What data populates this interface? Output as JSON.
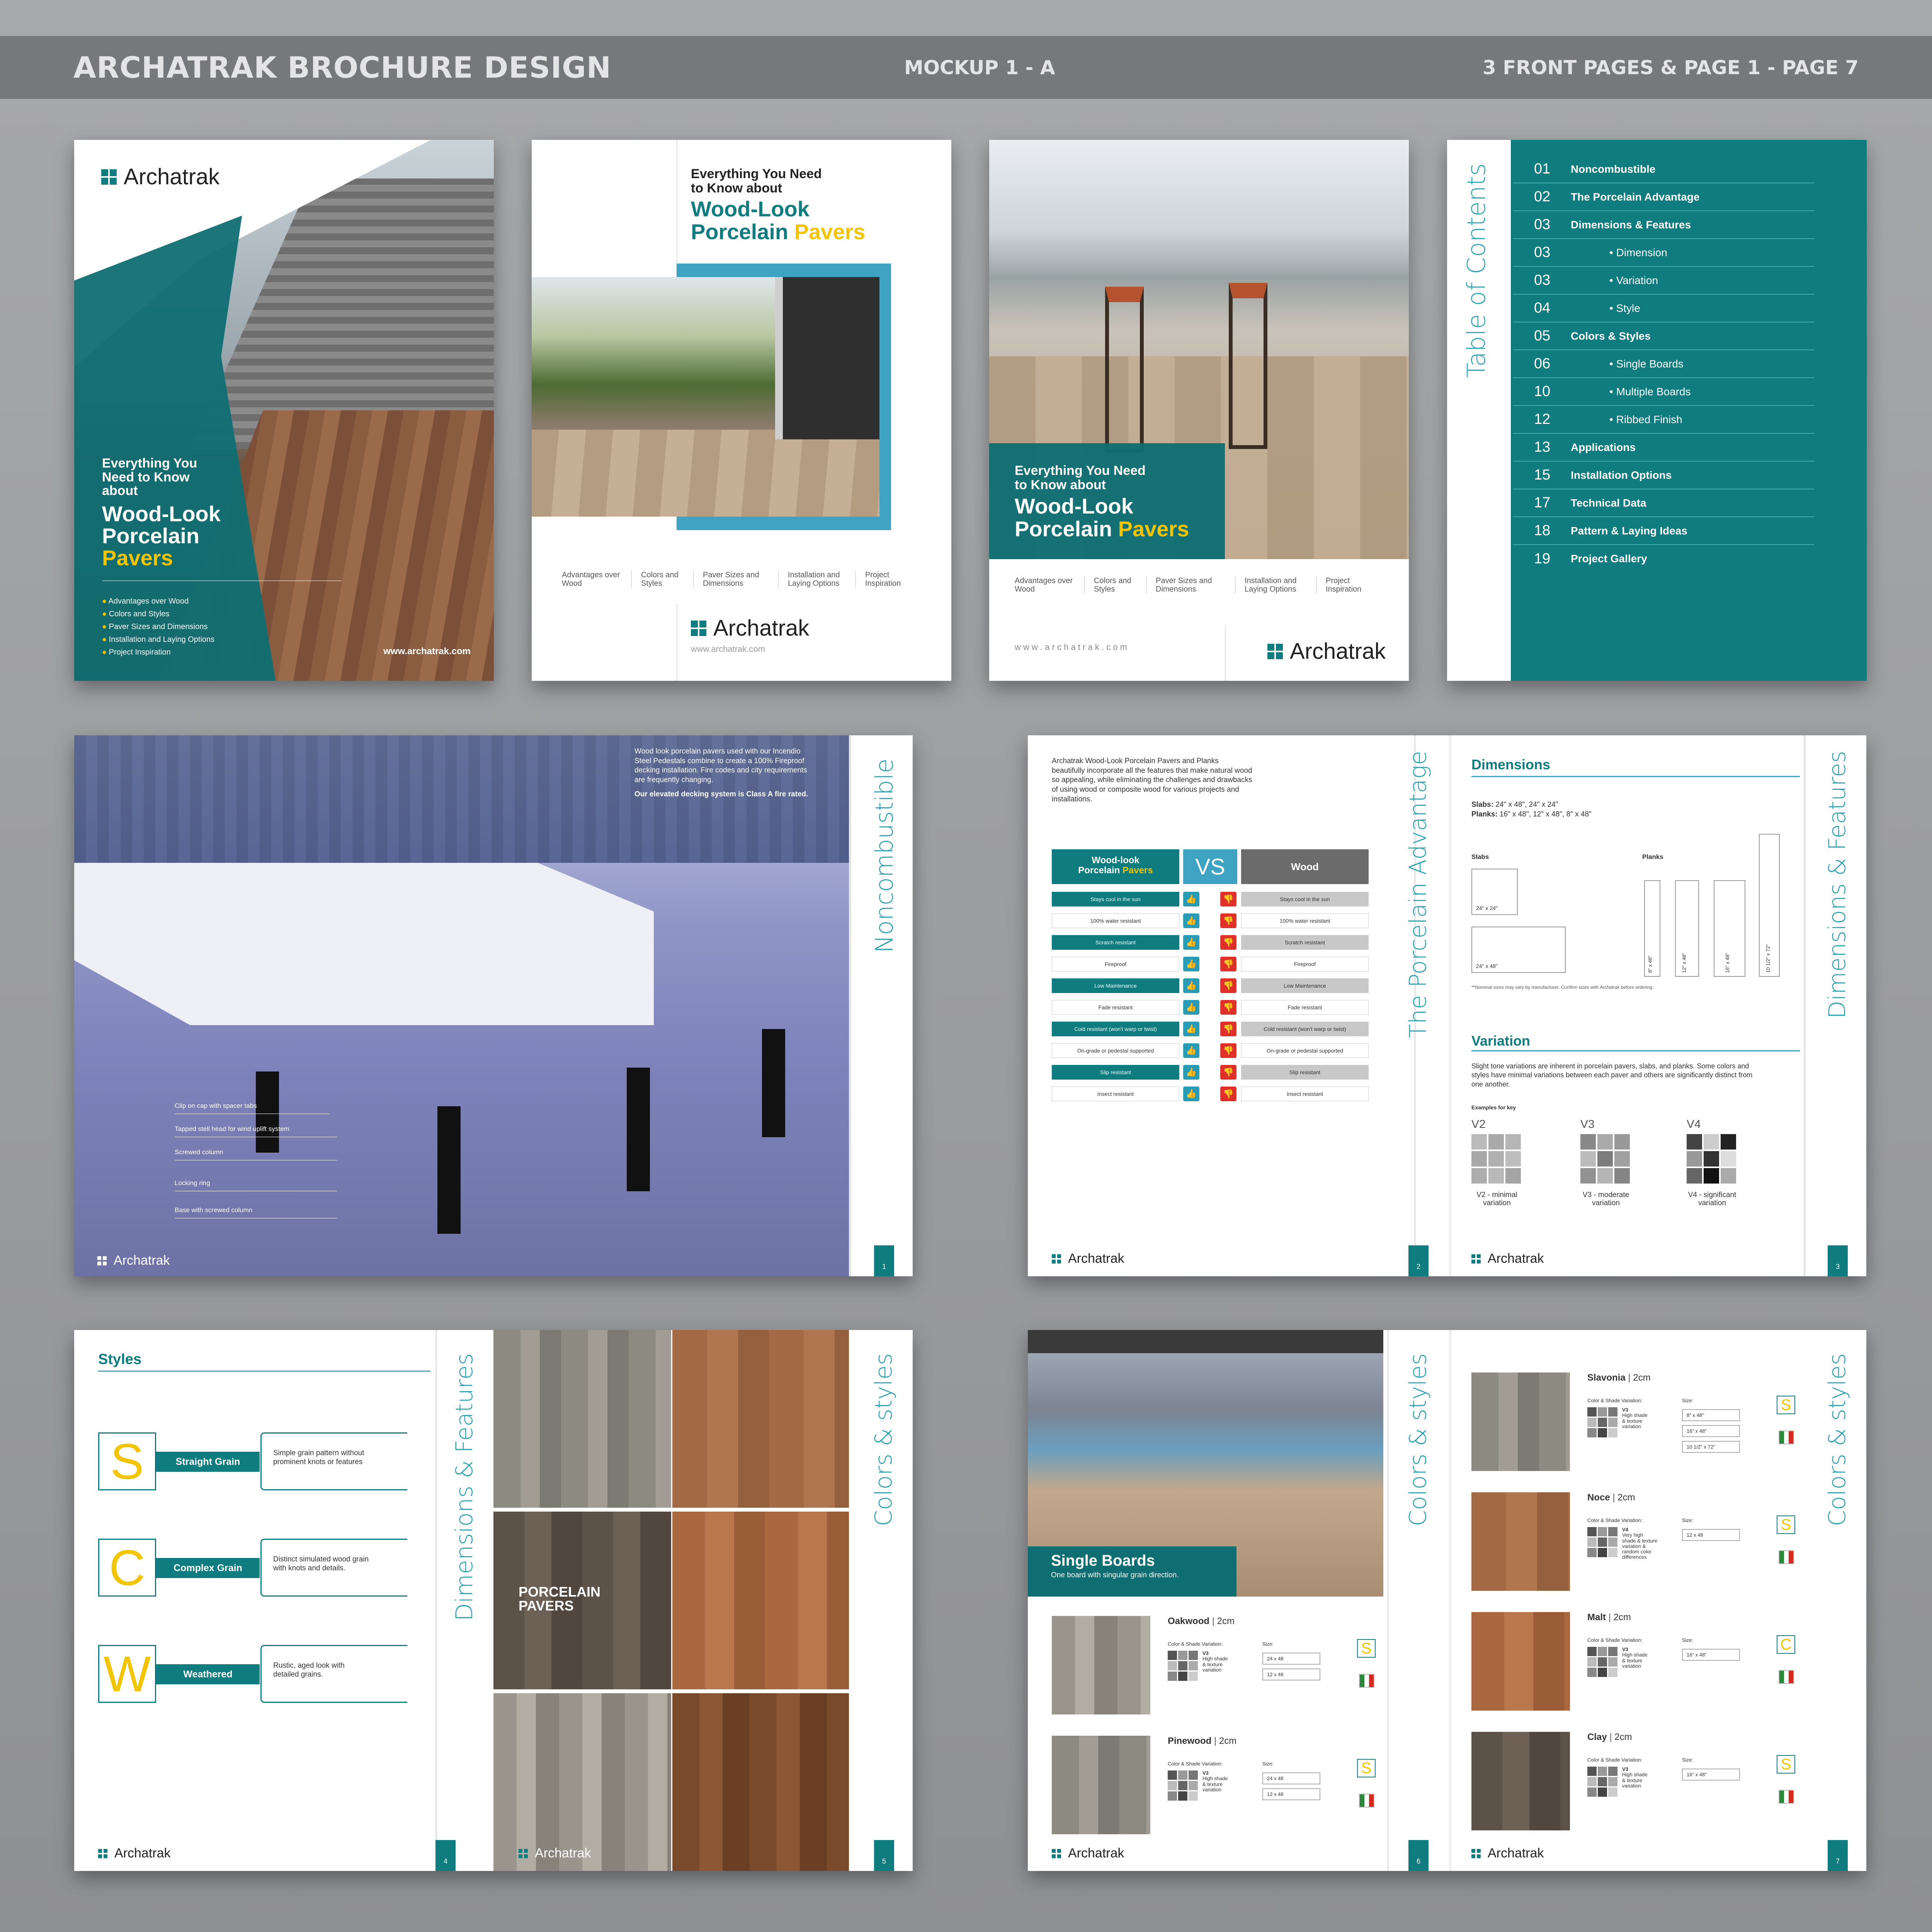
{
  "header": {
    "title": "ARCHATRAK BROCHURE DESIGN",
    "mockup": "MOCKUP 1 - A",
    "pages": "3 FRONT PAGES & PAGE 1 - PAGE 7"
  },
  "brand": {
    "name": "Archatrak",
    "url_cover": "www.archatrak.com",
    "url_plain": "www.archatrak.com",
    "url_spaced": "w w w . a r c h a t r a k . c o m",
    "teal": "#0f7c80",
    "yellow": "#f2c500"
  },
  "cover1": {
    "lead1": "Everything You",
    "lead2": "Need to Know",
    "lead3": "about",
    "h1": "Wood-Look",
    "h2": "Porcelain",
    "h3": "Pavers",
    "bullets": [
      "Advantages over Wood",
      "Colors and Styles",
      "Paver Sizes and Dimensions",
      "Installation and Laying Options",
      "Project Inspiration"
    ]
  },
  "cover2": {
    "lead1": "Everything You Need",
    "lead2": "to Know about",
    "h1": "Wood-Look",
    "h2a": "Porcelain ",
    "h2b": "Pavers",
    "nav": [
      "Advantages over Wood",
      "Colors and Styles",
      "Paver Sizes and Dimensions",
      "Installation and Laying Options",
      "Project Inspiration"
    ]
  },
  "cover3": {
    "lead1": "Everything You Need",
    "lead2": "to Know about",
    "h1": "Wood-Look",
    "h2a": "Porcelain ",
    "h2b": "Pavers",
    "nav": [
      "Advantages over Wood",
      "Colors and Styles",
      "Paver Sizes and Dimensions",
      "Installation and Laying Options",
      "Project Inspiration"
    ]
  },
  "toc": {
    "title": "Table of Contents",
    "items": [
      {
        "num": "01",
        "label": "Noncombustible",
        "sub": false
      },
      {
        "num": "02",
        "label": "The Porcelain Advantage",
        "sub": false
      },
      {
        "num": "03",
        "label": "Dimensions & Features",
        "sub": false
      },
      {
        "num": "03",
        "label": "Dimension",
        "sub": true
      },
      {
        "num": "03",
        "label": "Variation",
        "sub": true
      },
      {
        "num": "04",
        "label": "Style",
        "sub": true
      },
      {
        "num": "05",
        "label": "Colors & Styles",
        "sub": false
      },
      {
        "num": "06",
        "label": "Single Boards",
        "sub": true
      },
      {
        "num": "10",
        "label": "Multiple Boards",
        "sub": true
      },
      {
        "num": "12",
        "label": "Ribbed Finish",
        "sub": true
      },
      {
        "num": "13",
        "label": "Applications",
        "sub": false
      },
      {
        "num": "15",
        "label": "Installation Options",
        "sub": false
      },
      {
        "num": "17",
        "label": "Technical Data",
        "sub": false
      },
      {
        "num": "18",
        "label": "Pattern & Laying Ideas",
        "sub": false
      },
      {
        "num": "19",
        "label": "Project Gallery",
        "sub": false
      }
    ]
  },
  "page1": {
    "side_title": "Noncombustible",
    "intro": "Wood look porcelain pavers used with our Incendio Steel Pedestals combine to create a 100% Fireproof decking installation. Fire codes and city requirements are frequently changing.",
    "intro_bold": "Our elevated decking system is Class A fire rated.",
    "callouts": [
      "Clip on cap with spacer tabs",
      "Tapped stell head for wind uplift system",
      "Screwed column",
      "Locking ring",
      "Base with screwed column"
    ],
    "num": "1"
  },
  "page2": {
    "side_title": "The Porcelain Advantage",
    "intro": "Archatrak Wood-Look Porcelain Pavers and Planks beautifully incorporate all the features that make natural wood so appealing, while eliminating the challenges and drawbacks of using wood or composite wood for various projects and installations.",
    "left_head1": "Wood-look",
    "left_head2a": "Porcelain ",
    "left_head2b": "Pavers",
    "vs": "VS",
    "right_head": "Wood",
    "rows": [
      "Stays cool in the sun",
      "100% water resistant",
      "Scratch resistant",
      "Fireproof",
      "Low Maintenance",
      "Fade resistant",
      "Cold resistant (won't warp or twist)",
      "On-grade or pedestal supported",
      "Slip resistant",
      "Insect resistant"
    ],
    "num": "2"
  },
  "page3": {
    "side_title": "Dimensions & Features",
    "dim_head": "Dimensions",
    "slabs_label": "Slabs:",
    "slabs_val": " 24\" x 48\", 24\" x 24\"",
    "planks_label": "Planks:",
    "planks_val": " 16\" x 48\", 12\" x 48\", 8\" x 48\"",
    "slabs_title": "Slabs",
    "planks_title": "Planks",
    "slab_sizes": [
      "24\" x 24\"",
      "24\" x 48\""
    ],
    "plank_sizes": [
      "8\" x 48\"",
      "12\" x 48\"",
      "16\" x 48\"",
      "10 1/2\" x 72\""
    ],
    "note": "**Nominal sizes may vary by manufacturer. Confirm sizes with Archatrak before ordering.",
    "var_head": "Variation",
    "var_text": "Slight tone variations are inherent in porcelain pavers, slabs, and planks. Some colors and styles have minimal variations between each paver and others are significantly distinct from one another.",
    "examples": "Examples for key",
    "variants": [
      {
        "code": "V2",
        "cap1": "V2 - minimal",
        "cap2": "variation"
      },
      {
        "code": "V3",
        "cap1": "V3 - moderate",
        "cap2": "variation"
      },
      {
        "code": "V4",
        "cap1": "V4 - significant",
        "cap2": "variation"
      }
    ],
    "num": "3"
  },
  "page4": {
    "head": "Styles",
    "side_title": "Dimensions & Features",
    "styles": [
      {
        "letter": "S",
        "name": "Straight Grain",
        "desc1": "Simple grain pattern without",
        "desc2": "prominent knots or features"
      },
      {
        "letter": "C",
        "name": "Complex Grain",
        "desc1": "Distinct simulated wood grain",
        "desc2": "with knots and details."
      },
      {
        "letter": "W",
        "name": "Weathered",
        "desc1": "Rustic, aged look with",
        "desc2": "detailed grains."
      }
    ],
    "num": "4"
  },
  "page5": {
    "side_title": "Colors & styles",
    "overlay1": "PORCELAIN",
    "overlay2": "PAVERS",
    "num": "5"
  },
  "page6": {
    "side_title": "Colors & styles",
    "hero_title": "Single Boards",
    "hero_sub": "One board with singular grain direction.",
    "products": [
      {
        "name": "Oakwood",
        "thick": "2cm",
        "var": "V3",
        "vdesc": [
          "High shade",
          "& texture",
          "variation"
        ],
        "sizes": [
          "24 x 48",
          "12 x 48"
        ],
        "style": "S"
      },
      {
        "name": "Pinewood",
        "thick": "2cm",
        "var": "V3",
        "vdesc": [
          "High shade",
          "& texture",
          "variation"
        ],
        "sizes": [
          "24 x 48",
          "12 x 48"
        ],
        "style": "S"
      }
    ],
    "csv": "Color & Shade Variation:",
    "size": "Size:",
    "num": "6"
  },
  "page7": {
    "side_title": "Colors & styles",
    "products": [
      {
        "name": "Slavonia",
        "thick": "2cm",
        "var": "V3",
        "vdesc": [
          "High shade",
          "& texture",
          "variation"
        ],
        "sizes": [
          "8\" x 48\"",
          "16\" x 48\"",
          "10 1/2\" x 72\""
        ],
        "style": "S"
      },
      {
        "name": "Noce",
        "thick": "2cm",
        "var": "V4",
        "vdesc": [
          "Very high",
          "shade & texture",
          "variation &",
          "random color",
          "differences"
        ],
        "sizes": [
          "12 x 48"
        ],
        "style": "S"
      },
      {
        "name": "Malt",
        "thick": "2cm",
        "var": "V3",
        "vdesc": [
          "High shade",
          "& texture",
          "variation"
        ],
        "sizes": [
          "16\" x 48\""
        ],
        "style": "C"
      },
      {
        "name": "Clay",
        "thick": "2cm",
        "var": "V3",
        "vdesc": [
          "High shade",
          "& texture",
          "variation"
        ],
        "sizes": [
          "16\" x 48\""
        ],
        "style": "S"
      }
    ],
    "csv": "Color & Shade Variation:",
    "size": "Size:",
    "num": "7"
  }
}
